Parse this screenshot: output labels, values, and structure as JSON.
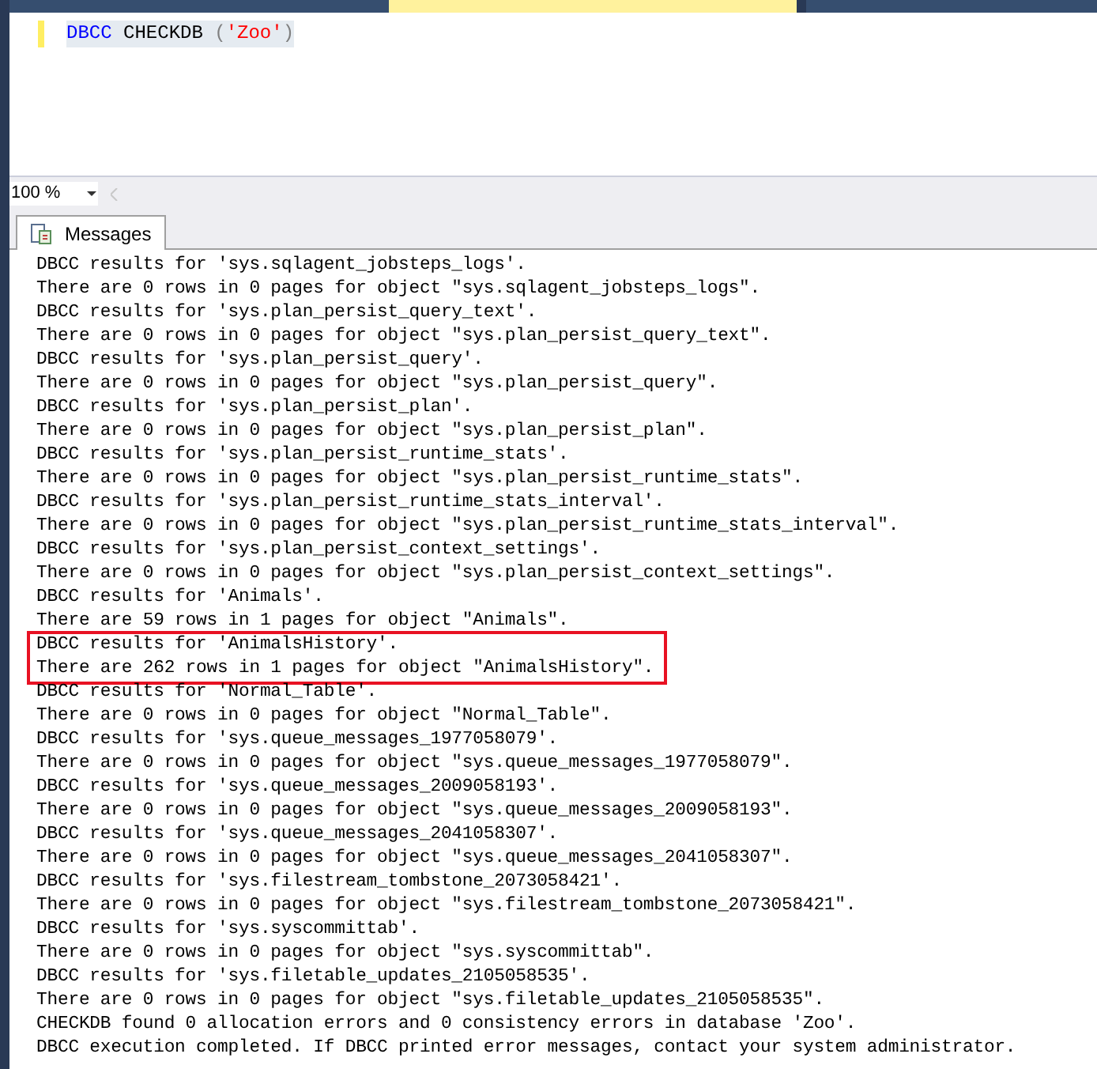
{
  "document_tabs": [
    {
      "selected": false
    },
    {
      "selected": true
    },
    {
      "selected": false
    }
  ],
  "editor": {
    "tokens": [
      {
        "text": "DBCC",
        "kind": "keyword"
      },
      {
        "text": " CHECKDB ",
        "kind": "plain"
      },
      {
        "text": "(",
        "kind": "punct"
      },
      {
        "text": "'Zoo'",
        "kind": "string"
      },
      {
        "text": ")",
        "kind": "punct"
      }
    ]
  },
  "zoom": {
    "value": "100 %"
  },
  "results_tabs": [
    {
      "label": "Messages",
      "selected": true
    }
  ],
  "messages": [
    {
      "text": "DBCC results for 'sys.sqlagent_jobsteps_logs'.",
      "highlighted": false
    },
    {
      "text": "There are 0 rows in 0 pages for object \"sys.sqlagent_jobsteps_logs\".",
      "highlighted": false
    },
    {
      "text": "DBCC results for 'sys.plan_persist_query_text'.",
      "highlighted": false
    },
    {
      "text": "There are 0 rows in 0 pages for object \"sys.plan_persist_query_text\".",
      "highlighted": false
    },
    {
      "text": "DBCC results for 'sys.plan_persist_query'.",
      "highlighted": false
    },
    {
      "text": "There are 0 rows in 0 pages for object \"sys.plan_persist_query\".",
      "highlighted": false
    },
    {
      "text": "DBCC results for 'sys.plan_persist_plan'.",
      "highlighted": false
    },
    {
      "text": "There are 0 rows in 0 pages for object \"sys.plan_persist_plan\".",
      "highlighted": false
    },
    {
      "text": "DBCC results for 'sys.plan_persist_runtime_stats'.",
      "highlighted": false
    },
    {
      "text": "There are 0 rows in 0 pages for object \"sys.plan_persist_runtime_stats\".",
      "highlighted": false
    },
    {
      "text": "DBCC results for 'sys.plan_persist_runtime_stats_interval'.",
      "highlighted": false
    },
    {
      "text": "There are 0 rows in 0 pages for object \"sys.plan_persist_runtime_stats_interval\".",
      "highlighted": false
    },
    {
      "text": "DBCC results for 'sys.plan_persist_context_settings'.",
      "highlighted": false
    },
    {
      "text": "There are 0 rows in 0 pages for object \"sys.plan_persist_context_settings\".",
      "highlighted": false
    },
    {
      "text": "DBCC results for 'Animals'.",
      "highlighted": false
    },
    {
      "text": "There are 59 rows in 1 pages for object \"Animals\".",
      "highlighted": false
    },
    {
      "text": "DBCC results for 'AnimalsHistory'.",
      "highlighted": true
    },
    {
      "text": "There are 262 rows in 1 pages for object \"AnimalsHistory\".",
      "highlighted": true
    },
    {
      "text": "DBCC results for 'Normal_Table'.",
      "highlighted": false
    },
    {
      "text": "There are 0 rows in 0 pages for object \"Normal_Table\".",
      "highlighted": false
    },
    {
      "text": "DBCC results for 'sys.queue_messages_1977058079'.",
      "highlighted": false
    },
    {
      "text": "There are 0 rows in 0 pages for object \"sys.queue_messages_1977058079\".",
      "highlighted": false
    },
    {
      "text": "DBCC results for 'sys.queue_messages_2009058193'.",
      "highlighted": false
    },
    {
      "text": "There are 0 rows in 0 pages for object \"sys.queue_messages_2009058193\".",
      "highlighted": false
    },
    {
      "text": "DBCC results for 'sys.queue_messages_2041058307'.",
      "highlighted": false
    },
    {
      "text": "There are 0 rows in 0 pages for object \"sys.queue_messages_2041058307\".",
      "highlighted": false
    },
    {
      "text": "DBCC results for 'sys.filestream_tombstone_2073058421'.",
      "highlighted": false
    },
    {
      "text": "There are 0 rows in 0 pages for object \"sys.filestream_tombstone_2073058421\".",
      "highlighted": false
    },
    {
      "text": "DBCC results for 'sys.syscommittab'.",
      "highlighted": false
    },
    {
      "text": "There are 0 rows in 0 pages for object \"sys.syscommittab\".",
      "highlighted": false
    },
    {
      "text": "DBCC results for 'sys.filetable_updates_2105058535'.",
      "highlighted": false
    },
    {
      "text": "There are 0 rows in 0 pages for object \"sys.filetable_updates_2105058535\".",
      "highlighted": false
    },
    {
      "text": "CHECKDB found 0 allocation errors and 0 consistency errors in database 'Zoo'.",
      "highlighted": false
    },
    {
      "text": "DBCC execution completed. If DBCC printed error messages, contact your system administrator.",
      "highlighted": false
    }
  ]
}
